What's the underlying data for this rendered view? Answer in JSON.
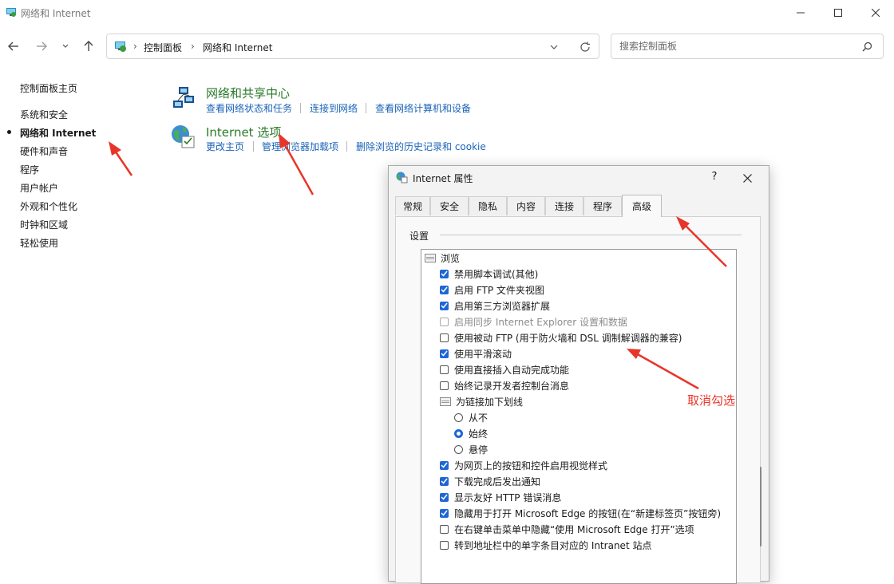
{
  "window": {
    "title": "网络和 Internet"
  },
  "address": {
    "root": "控制面板",
    "current": "网络和 Internet"
  },
  "search": {
    "placeholder": "搜索控制面板"
  },
  "sidebar": {
    "home": "控制面板主页",
    "items": [
      {
        "label": "系统和安全"
      },
      {
        "label": "网络和 Internet",
        "active": true
      },
      {
        "label": "硬件和声音"
      },
      {
        "label": "程序"
      },
      {
        "label": "用户帐户"
      },
      {
        "label": "外观和个性化"
      },
      {
        "label": "时钟和区域"
      },
      {
        "label": "轻松使用"
      }
    ]
  },
  "categories": [
    {
      "title": "网络和共享中心",
      "links": [
        "查看网络状态和任务",
        "连接到网络",
        "查看网络计算机和设备"
      ]
    },
    {
      "title": "Internet 选项",
      "links": [
        "更改主页",
        "管理浏览器加载项",
        "删除浏览的历史记录和 cookie"
      ]
    }
  ],
  "dialog": {
    "title": "Internet 属性",
    "help": "?",
    "tabs": [
      "常规",
      "安全",
      "隐私",
      "内容",
      "连接",
      "程序",
      "高级"
    ],
    "selected_tab": "高级",
    "group_label": "设置",
    "settings": [
      {
        "type": "group",
        "label": "浏览"
      },
      {
        "type": "checkbox",
        "label": "禁用脚本调试(其他)",
        "checked": true
      },
      {
        "type": "checkbox",
        "label": "启用 FTP 文件夹视图",
        "checked": true
      },
      {
        "type": "checkbox",
        "label": "启用第三方浏览器扩展",
        "checked": true
      },
      {
        "type": "checkbox",
        "label": "启用同步 Internet Explorer 设置和数据",
        "checked": false,
        "disabled": true
      },
      {
        "type": "checkbox",
        "label": "使用被动 FTP (用于防火墙和 DSL 调制解调器的兼容)",
        "checked": false
      },
      {
        "type": "checkbox",
        "label": "使用平滑滚动",
        "checked": true
      },
      {
        "type": "checkbox",
        "label": "使用直接插入自动完成功能",
        "checked": false
      },
      {
        "type": "checkbox",
        "label": "始终记录开发者控制台消息",
        "checked": false
      },
      {
        "type": "group",
        "label": "为链接加下划线"
      },
      {
        "type": "radio",
        "label": "从不",
        "checked": false
      },
      {
        "type": "radio",
        "label": "始终",
        "checked": true
      },
      {
        "type": "radio",
        "label": "悬停",
        "checked": false
      },
      {
        "type": "checkbox",
        "label": "为网页上的按钮和控件启用视觉样式",
        "checked": true
      },
      {
        "type": "checkbox",
        "label": "下载完成后发出通知",
        "checked": true
      },
      {
        "type": "checkbox",
        "label": "显示友好 HTTP 错误消息",
        "checked": true
      },
      {
        "type": "checkbox",
        "label": "隐藏用于打开 Microsoft Edge 的按钮(在“新建标签页”按钮旁)",
        "checked": true
      },
      {
        "type": "checkbox",
        "label": "在右键单击菜单中隐藏“使用 Microsoft Edge 打开”选项",
        "checked": false
      },
      {
        "type": "checkbox",
        "label": "转到地址栏中的单字条目对应的 Intranet 站点",
        "checked": false
      }
    ]
  },
  "annotation": {
    "text": "取消勾选",
    "color": "#e8352a"
  },
  "colors": {
    "link": "#1a63b8",
    "category_title": "#2b7a2b",
    "checkbox": "#1e66d6",
    "arrow": "#e8352a"
  },
  "icons": {
    "window": "network-globe-icon",
    "back": "back-arrow-icon",
    "forward": "forward-arrow-icon",
    "recent": "chevron-down-icon",
    "up": "up-arrow-icon",
    "refresh": "refresh-icon",
    "search": "search-icon",
    "network_center": "network-center-icon",
    "internet_options": "internet-options-icon"
  }
}
